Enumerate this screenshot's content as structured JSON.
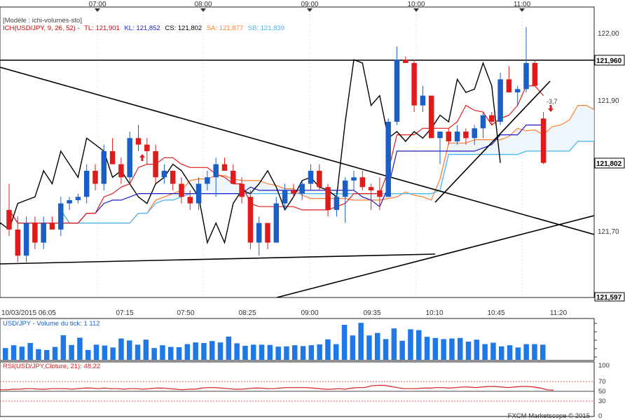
{
  "header": {
    "template_label": "[Modèle : ichi-volumes-sto]",
    "ich_label": "ICH(USD/JPY, 9, 26, 52) -",
    "tl_label": "TL: 121,901",
    "kl_label": "KL: 121,852",
    "cs_label": "CS: 121,802",
    "sa_label": "SA: 121,877",
    "sb_label": "SB: 121,839"
  },
  "top_times": [
    "07:00",
    "08:00",
    "09:00",
    "10:00",
    "11:00"
  ],
  "bottom_times": [
    "10/03/2015 06:05",
    "07:15",
    "07:50",
    "08:25",
    "09:00",
    "09:35",
    "10:10",
    "10:45",
    "11:20"
  ],
  "price_ticks": [
    "122,00",
    "121,90",
    "121,70"
  ],
  "price_flags": [
    "121,960",
    "121,802",
    "121,597"
  ],
  "annotation": "-3,7",
  "volume_label": "USD/JPY - Volume du tick: 1 112",
  "rsi_label": "RSI(USD/JPY,Cloture, 21): 48,22",
  "rsi_ticks": [
    "100",
    "70",
    "50",
    "30",
    "0"
  ],
  "footer": "FXCM Marketscope © 2015",
  "colors": {
    "up": "#1a5fc8",
    "down": "#e01b1b",
    "tenkan": "#e01b1b",
    "kijun": "#1c1ccc",
    "chikou": "#000000",
    "span_a": "#ff7d2e",
    "span_b": "#40b4f0",
    "volume": "#1e78e6",
    "rsi": "#d42020"
  },
  "chart_data": [
    {
      "type": "candlestick",
      "title": "USD/JPY 5 min",
      "ylim": [
        121.597,
        122.03
      ],
      "x": [
        "06:05",
        "06:10",
        "06:15",
        "06:20",
        "06:25",
        "06:30",
        "06:35",
        "06:40",
        "06:45",
        "06:50",
        "06:55",
        "07:00",
        "07:05",
        "07:10",
        "07:15",
        "07:20",
        "07:25",
        "07:30",
        "07:35",
        "07:40",
        "07:45",
        "07:50",
        "07:55",
        "08:00",
        "08:05",
        "08:10",
        "08:15",
        "08:20",
        "08:25",
        "08:30",
        "08:35",
        "08:40",
        "08:45",
        "08:50",
        "08:55",
        "09:00",
        "09:05",
        "09:10",
        "09:15",
        "09:20",
        "09:25",
        "09:30",
        "09:35",
        "09:40",
        "09:45",
        "09:50",
        "09:55",
        "10:00",
        "10:05",
        "10:10",
        "10:15",
        "10:20",
        "10:25",
        "10:30",
        "10:35",
        "10:40",
        "10:45",
        "10:50",
        "10:55",
        "11:00",
        "11:05",
        "11:10",
        "11:15"
      ],
      "candles": [
        {
          "o": 121.73,
          "h": 121.77,
          "l": 121.69,
          "c": 121.7
        },
        {
          "o": 121.7,
          "h": 121.72,
          "l": 121.65,
          "c": 121.66
        },
        {
          "o": 121.66,
          "h": 121.72,
          "l": 121.65,
          "c": 121.71
        },
        {
          "o": 121.71,
          "h": 121.72,
          "l": 121.67,
          "c": 121.68
        },
        {
          "o": 121.68,
          "h": 121.72,
          "l": 121.67,
          "c": 121.71
        },
        {
          "o": 121.71,
          "h": 121.72,
          "l": 121.7,
          "c": 121.7
        },
        {
          "o": 121.7,
          "h": 121.75,
          "l": 121.69,
          "c": 121.74
        },
        {
          "o": 121.74,
          "h": 121.75,
          "l": 121.73,
          "c": 121.745
        },
        {
          "o": 121.745,
          "h": 121.755,
          "l": 121.74,
          "c": 121.75
        },
        {
          "o": 121.75,
          "h": 121.8,
          "l": 121.74,
          "c": 121.79
        },
        {
          "o": 121.79,
          "h": 121.8,
          "l": 121.76,
          "c": 121.77
        },
        {
          "o": 121.77,
          "h": 121.83,
          "l": 121.76,
          "c": 121.82
        },
        {
          "o": 121.82,
          "h": 121.84,
          "l": 121.8,
          "c": 121.8
        },
        {
          "o": 121.8,
          "h": 121.81,
          "l": 121.77,
          "c": 121.78
        },
        {
          "o": 121.78,
          "h": 121.85,
          "l": 121.77,
          "c": 121.84
        },
        {
          "o": 121.84,
          "h": 121.86,
          "l": 121.82,
          "c": 121.83
        },
        {
          "o": 121.83,
          "h": 121.84,
          "l": 121.8,
          "c": 121.82
        },
        {
          "o": 121.82,
          "h": 121.83,
          "l": 121.77,
          "c": 121.78
        },
        {
          "o": 121.78,
          "h": 121.8,
          "l": 121.77,
          "c": 121.79
        },
        {
          "o": 121.79,
          "h": 121.79,
          "l": 121.76,
          "c": 121.77
        },
        {
          "o": 121.77,
          "h": 121.78,
          "l": 121.74,
          "c": 121.75
        },
        {
          "o": 121.75,
          "h": 121.76,
          "l": 121.73,
          "c": 121.74
        },
        {
          "o": 121.74,
          "h": 121.78,
          "l": 121.73,
          "c": 121.77
        },
        {
          "o": 121.77,
          "h": 121.79,
          "l": 121.76,
          "c": 121.78
        },
        {
          "o": 121.78,
          "h": 121.81,
          "l": 121.75,
          "c": 121.8
        },
        {
          "o": 121.8,
          "h": 121.81,
          "l": 121.79,
          "c": 121.79
        },
        {
          "o": 121.79,
          "h": 121.8,
          "l": 121.77,
          "c": 121.77
        },
        {
          "o": 121.77,
          "h": 121.78,
          "l": 121.74,
          "c": 121.75
        },
        {
          "o": 121.75,
          "h": 121.76,
          "l": 121.67,
          "c": 121.68
        },
        {
          "o": 121.68,
          "h": 121.72,
          "l": 121.66,
          "c": 121.71
        },
        {
          "o": 121.71,
          "h": 121.71,
          "l": 121.67,
          "c": 121.68
        },
        {
          "o": 121.68,
          "h": 121.75,
          "l": 121.68,
          "c": 121.74
        },
        {
          "o": 121.74,
          "h": 121.77,
          "l": 121.73,
          "c": 121.76
        },
        {
          "o": 121.76,
          "h": 121.77,
          "l": 121.75,
          "c": 121.755
        },
        {
          "o": 121.755,
          "h": 121.775,
          "l": 121.745,
          "c": 121.77
        },
        {
          "o": 121.77,
          "h": 121.8,
          "l": 121.76,
          "c": 121.79
        },
        {
          "o": 121.79,
          "h": 121.8,
          "l": 121.76,
          "c": 121.765
        },
        {
          "o": 121.765,
          "h": 121.77,
          "l": 121.72,
          "c": 121.73
        },
        {
          "o": 121.73,
          "h": 121.76,
          "l": 121.72,
          "c": 121.75
        },
        {
          "o": 121.75,
          "h": 121.78,
          "l": 121.71,
          "c": 121.775
        },
        {
          "o": 121.775,
          "h": 121.79,
          "l": 121.76,
          "c": 121.78
        },
        {
          "o": 121.78,
          "h": 121.79,
          "l": 121.76,
          "c": 121.765
        },
        {
          "o": 121.765,
          "h": 121.77,
          "l": 121.73,
          "c": 121.76
        },
        {
          "o": 121.76,
          "h": 121.78,
          "l": 121.73,
          "c": 121.75
        },
        {
          "o": 121.75,
          "h": 121.87,
          "l": 121.75,
          "c": 121.865
        },
        {
          "o": 121.865,
          "h": 121.98,
          "l": 121.86,
          "c": 121.96
        },
        {
          "o": 121.96,
          "h": 121.965,
          "l": 121.955,
          "c": 121.955
        },
        {
          "o": 121.955,
          "h": 121.96,
          "l": 121.88,
          "c": 121.89
        },
        {
          "o": 121.89,
          "h": 121.92,
          "l": 121.88,
          "c": 121.905
        },
        {
          "o": 121.905,
          "h": 121.905,
          "l": 121.84,
          "c": 121.84
        },
        {
          "o": 121.84,
          "h": 121.85,
          "l": 121.8,
          "c": 121.85
        },
        {
          "o": 121.85,
          "h": 121.855,
          "l": 121.83,
          "c": 121.835
        },
        {
          "o": 121.835,
          "h": 121.86,
          "l": 121.83,
          "c": 121.85
        },
        {
          "o": 121.85,
          "h": 121.855,
          "l": 121.83,
          "c": 121.84
        },
        {
          "o": 121.84,
          "h": 121.86,
          "l": 121.83,
          "c": 121.855
        },
        {
          "o": 121.855,
          "h": 121.88,
          "l": 121.84,
          "c": 121.875
        },
        {
          "o": 121.875,
          "h": 121.88,
          "l": 121.86,
          "c": 121.865
        },
        {
          "o": 121.865,
          "h": 121.94,
          "l": 121.86,
          "c": 121.93
        },
        {
          "o": 121.93,
          "h": 121.95,
          "l": 121.91,
          "c": 121.91
        },
        {
          "o": 121.91,
          "h": 121.92,
          "l": 121.89,
          "c": 121.915
        },
        {
          "o": 121.915,
          "h": 122.01,
          "l": 121.91,
          "c": 121.955
        },
        {
          "o": 121.955,
          "h": 121.96,
          "l": 121.92,
          "c": 121.92
        },
        {
          "o": 121.87,
          "h": 121.88,
          "l": 121.8,
          "c": 121.802
        }
      ]
    },
    {
      "type": "bar",
      "title": "USD/JPY - Volume du tick",
      "values": [
        420,
        520,
        470,
        600,
        380,
        350,
        460,
        880,
        530,
        790,
        350,
        540,
        510,
        440,
        760,
        690,
        540,
        720,
        420,
        520,
        460,
        450,
        560,
        620,
        600,
        670,
        620,
        830,
        590,
        500,
        540,
        540,
        530,
        470,
        480,
        520,
        490,
        520,
        550,
        730,
        560,
        1250,
        870,
        1320,
        870,
        960,
        740,
        1120,
        680,
        1090,
        1060,
        820,
        780,
        740,
        760,
        780,
        650,
        720,
        560,
        610,
        480,
        520,
        440,
        560,
        560,
        540
      ]
    },
    {
      "type": "line",
      "title": "RSI(USD/JPY,Cloture, 21)",
      "ylim": [
        0,
        100
      ],
      "values": [
        49,
        49,
        50,
        50,
        51,
        51,
        50,
        50,
        51,
        51,
        51,
        50,
        51,
        52,
        52,
        51,
        52,
        51,
        51,
        50,
        51,
        51,
        50,
        51,
        52,
        52,
        51,
        50,
        49,
        50,
        50,
        52,
        53,
        53,
        52,
        51,
        50,
        50,
        51,
        52,
        52,
        51,
        51,
        52,
        53,
        53,
        53,
        53,
        52,
        51,
        50,
        50,
        51,
        50,
        52,
        53,
        53,
        56,
        57,
        57,
        55,
        53,
        51,
        51,
        51,
        52,
        52,
        53,
        53,
        52,
        53,
        54,
        54,
        53,
        54,
        55,
        55,
        54,
        53,
        54,
        55,
        55,
        54,
        52,
        49,
        48.22
      ]
    }
  ]
}
